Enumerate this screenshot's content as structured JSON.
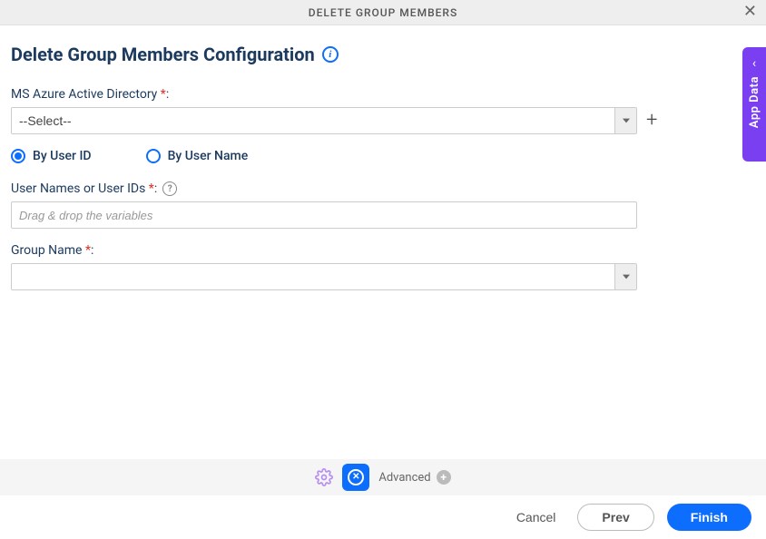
{
  "header": {
    "title": "DELETE GROUP MEMBERS"
  },
  "page": {
    "title": "Delete Group Members Configuration"
  },
  "fields": {
    "azureDirectory": {
      "label": "MS Azure Active Directory",
      "value": "--Select--"
    },
    "radios": {
      "byUserId": "By User ID",
      "byUserName": "By User Name",
      "selected": "byUserId"
    },
    "userNames": {
      "label": "User Names or User IDs",
      "placeholder": "Drag & drop the variables"
    },
    "groupName": {
      "label": "Group Name",
      "value": ""
    }
  },
  "sideTab": {
    "label": "App Data"
  },
  "toolbar": {
    "advanced": "Advanced"
  },
  "footer": {
    "cancel": "Cancel",
    "prev": "Prev",
    "finish": "Finish"
  }
}
